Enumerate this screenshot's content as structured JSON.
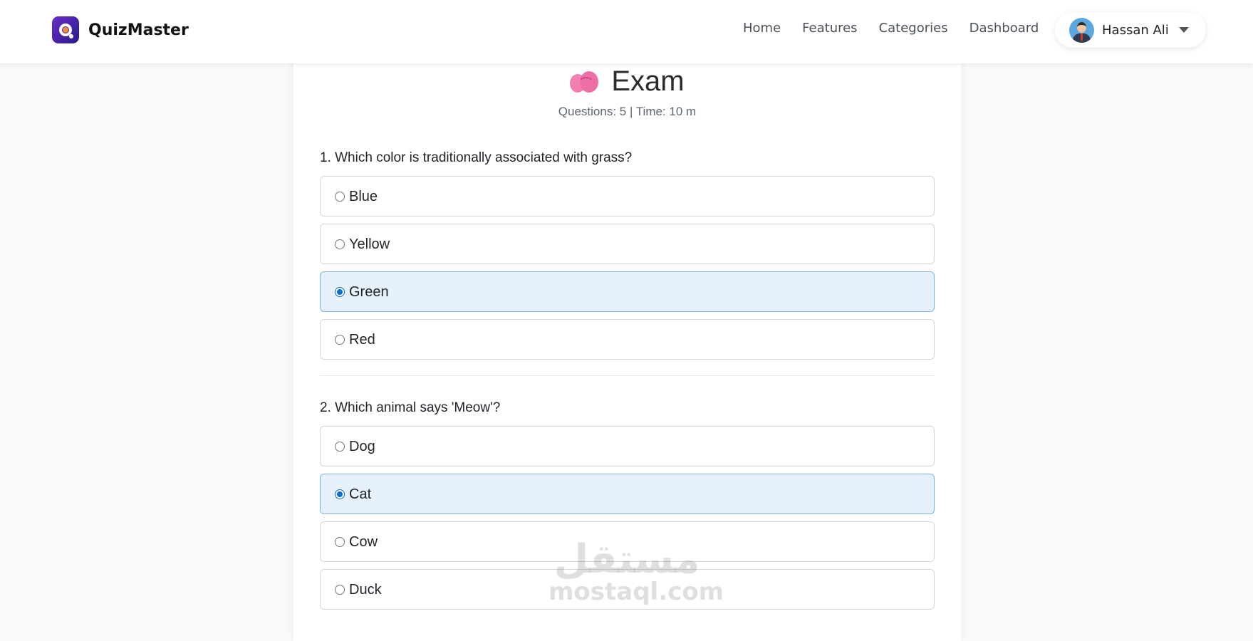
{
  "app": {
    "brand_name": "QuizMaster"
  },
  "nav": {
    "links": [
      "Home",
      "Features",
      "Categories",
      "Dashboard"
    ],
    "user_name": "Hassan Ali"
  },
  "exam": {
    "title": "Exam",
    "meta": "Questions: 5 | Time: 10 m"
  },
  "questions": [
    {
      "text": "1. Which color is traditionally associated with grass?",
      "options": [
        "Blue",
        "Yellow",
        "Green",
        "Red"
      ],
      "selected": "Green"
    },
    {
      "text": "2. Which animal says 'Meow'?",
      "options": [
        "Dog",
        "Cat",
        "Cow",
        "Duck"
      ],
      "selected": "Cat"
    }
  ],
  "watermark": {
    "arabic": "مستقل",
    "latin": "mostaql.com"
  },
  "colors": {
    "brand": "#4b2bb0",
    "selected_bg": "#e7f1fe",
    "selected_border": "#7fb0ea",
    "radio_checked": "#0b6fd4"
  },
  "icons": {
    "brand_logo": "quizmaster-logo-icon",
    "title": "brain-icon",
    "user_menu": "chevron-down-icon"
  }
}
